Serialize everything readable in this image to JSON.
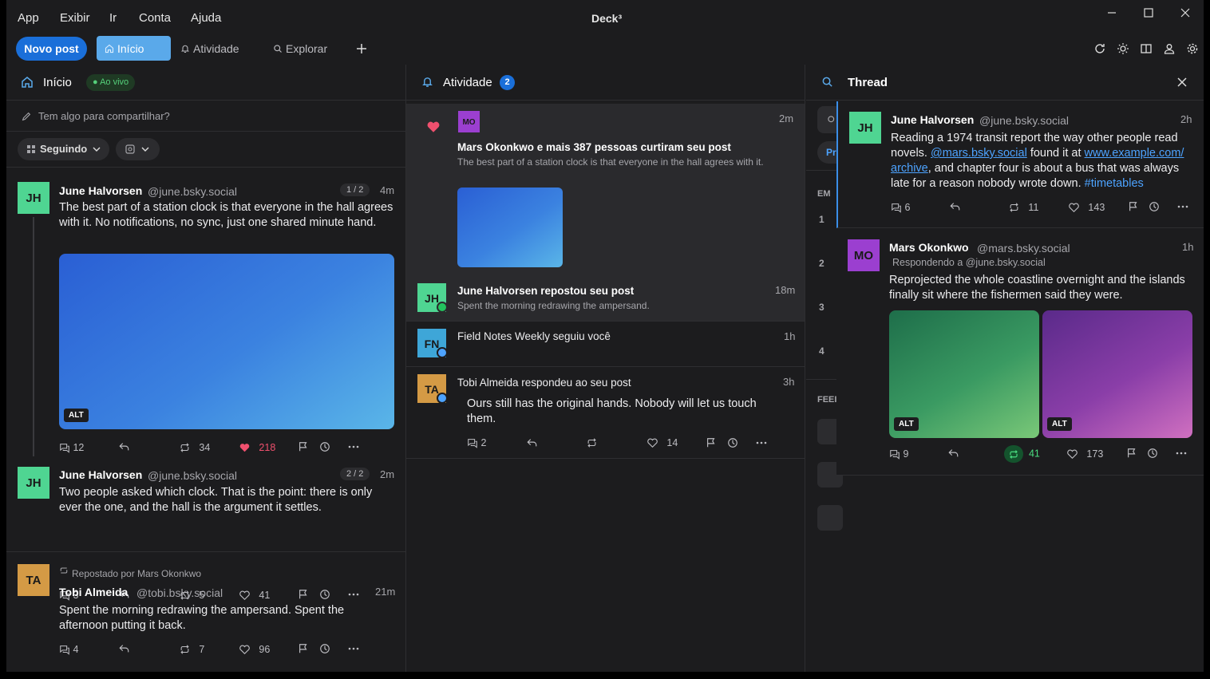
{
  "app": {
    "title": "Deck³",
    "menu": [
      "App",
      "Exibir",
      "Ir",
      "Conta",
      "Ajuda"
    ]
  },
  "toolbar": {
    "new_post": "Novo post",
    "tabs": [
      "Início",
      "Atividade",
      "Explorar"
    ]
  },
  "home": {
    "title": "Início",
    "live": "● Ao vivo",
    "compose": "Tem algo para compartilhar?",
    "filter": "Seguindo",
    "posts": [
      {
        "initials": "JH",
        "name": "June Halvorsen",
        "handle": "@june.bsky.social",
        "badge": "1 / 2",
        "time": "4m",
        "text": "The best part of a station clock is that everyone in the hall agrees with it. No notifications, no sync, just one shared minute hand.",
        "alt": "ALT",
        "replies": "12",
        "reposts": "34",
        "likes": "218"
      },
      {
        "initials": "JH",
        "name": "June Halvorsen",
        "handle": "@june.bsky.social",
        "badge": "2 / 2",
        "time": "2m",
        "text": "Two people asked which clock. That is the point: there is only ever the one, and the hall is the argument it settles.",
        "replies": "3",
        "reposts": "5",
        "likes": "41"
      },
      {
        "initials": "TA",
        "repost": "Repostado por Mars Okonkwo",
        "name": "Tobi Almeida",
        "handle": "@tobi.bsky.social",
        "time": "21m",
        "text": "Spent the morning redrawing the ampersand. Spent the afternoon putting it back.",
        "replies": "4",
        "reposts": "7",
        "likes": "96"
      }
    ]
  },
  "activity": {
    "title": "Atividade",
    "count": "2",
    "items": [
      {
        "initials": "MO",
        "title": "Mars Okonkwo e mais 387 pessoas curtiram seu post",
        "sub": "The best part of a station clock is that everyone in the hall agrees with it.",
        "time": "2m"
      },
      {
        "initials": "JH",
        "title": "June Halvorsen repostou seu post",
        "sub": "Spent the morning redrawing the ampersand.",
        "time": "18m"
      },
      {
        "initials": "FN",
        "title": "Field Notes Weekly seguiu você",
        "time": "1h"
      },
      {
        "initials": "TA",
        "title": "Tobi Almeida respondeu ao seu post",
        "sub": "Ours still has the original hands. Nobody will let us touch them.",
        "time": "3h",
        "replies": "2",
        "likes": "14"
      }
    ]
  },
  "thread": {
    "title": "Thread",
    "hidden_col": {
      "em": "EM",
      "nums": [
        "1",
        "2",
        "3",
        "4"
      ],
      "feed": "FEEI",
      "pill": "Pr"
    },
    "main": {
      "initials": "JH",
      "name": "June Halvorsen",
      "handle": "@june.bsky.social",
      "time": "2h",
      "t1": "Reading a 1974 transit report the way other people read novels. ",
      "link1": "@mars.bsky.social",
      "t2": " found it at ",
      "link2a": "www.example.com/",
      "link2b": "archive",
      "t3": ", and chapter four is about a bus that was always late for a reason nobody wrote down. ",
      "tag": "#timetables",
      "replies": "6",
      "reposts": "11",
      "likes": "143"
    },
    "reply": {
      "initials": "MO",
      "name": "Mars Okonkwo",
      "handle": "@mars.bsky.social",
      "time": "1h",
      "replying": "Respondendo a @june.bsky.social",
      "text": "Reprojected the whole coastline overnight and the islands finally sit where the fishermen said they were.",
      "alt": "ALT",
      "replies": "9",
      "reposts": "41",
      "likes": "173"
    }
  },
  "colors": {
    "accent": "#1a6fd9",
    "like": "#f0506e",
    "green": "#4ade80",
    "jh": "#4fd592",
    "mo": "#9b3fd0",
    "ta": "#d49a45",
    "fn": "#3ea6d8"
  }
}
